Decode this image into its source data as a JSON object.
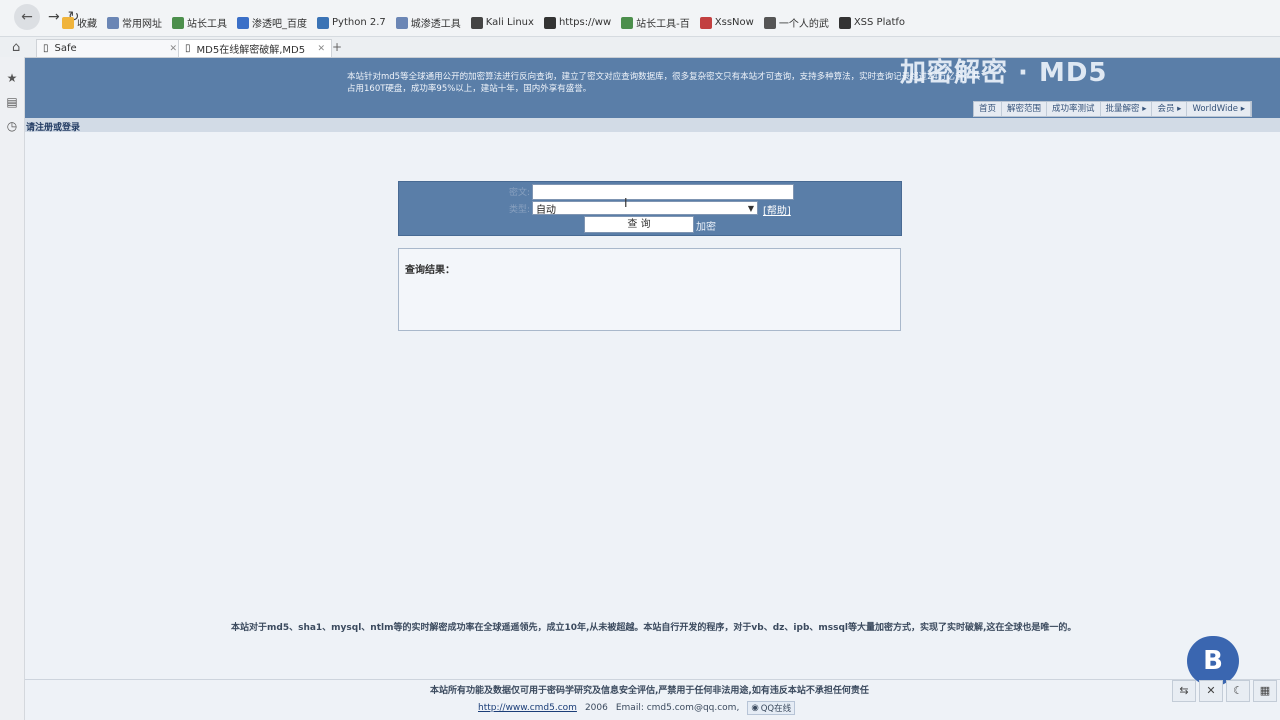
{
  "browser": {
    "bookmarks": [
      {
        "label": "收藏",
        "icon": "star-icon",
        "color": "#f0b43c"
      },
      {
        "label": "常用网址",
        "icon": "folder-icon",
        "color": "#6b86b5"
      },
      {
        "label": "站长工具",
        "icon": "tool-icon",
        "color": "#4c8f4c"
      },
      {
        "label": "渗透吧_百度",
        "icon": "paw-icon",
        "color": "#3a6fc7"
      },
      {
        "label": "Python 2.7",
        "icon": "python-icon",
        "color": "#3a73b5"
      },
      {
        "label": "城渗透工具",
        "icon": "folder-icon",
        "color": "#6b86b5"
      },
      {
        "label": "Kali Linux",
        "icon": "kali-icon",
        "color": "#444"
      },
      {
        "label": "https://ww",
        "icon": "page-icon",
        "color": "#333"
      },
      {
        "label": "站长工具-百",
        "icon": "tool-icon",
        "color": "#4c8f4c"
      },
      {
        "label": "XssNow",
        "icon": "x-icon",
        "color": "#c24040"
      },
      {
        "label": "一个人的武",
        "icon": "f-icon",
        "color": "#555"
      },
      {
        "label": "XSS Platfo",
        "icon": "xss-icon",
        "color": "#333"
      }
    ],
    "tabs": [
      {
        "label": "Safe"
      },
      {
        "label": "MD5在线解密破解,MD5"
      }
    ]
  },
  "site": {
    "header_text": "本站针对md5等全球通用公开的加密算法进行反向查询，建立了密文对应查询数据库，很多复杂密文只有本站才可查询，支持多种算法，实时查询记录超过24万亿条，共占用160T硬盘，成功率95%以上，建站十年，国内外享有盛誉。",
    "banner": "加密解密 · MD5",
    "nav": [
      "首页",
      "解密范围",
      "成功率测试",
      "批量解密 ▸",
      "会员 ▸",
      "WorldWide ▸"
    ],
    "login": "请注册或登录"
  },
  "form": {
    "label_cipher": "密文:",
    "label_type": "类型:",
    "input_value": "",
    "type_selected": "自动",
    "help": "[帮助]",
    "submit": "查 询",
    "encrypt": "加密"
  },
  "result": {
    "title": "查询结果："
  },
  "footer": {
    "line1": "本站对于md5、sha1、mysql、ntlm等的实时解密成功率在全球遥遥领先，成立10年,从未被超越。本站自行开发的程序，对于vb、dz、ipb、mssql等大量加密方式，实现了实时破解,这在全球也是唯一的。",
    "line2": "本站所有功能及数据仅可用于密码学研究及信息安全评估,严禁用于任何非法用途,如有违反本站不承担任何责任",
    "url": "http://www.cmd5.com",
    "year": "2006",
    "email": "Email: cmd5.com@qq.com,",
    "qq": "QQ在线"
  },
  "widgets": {
    "logo_letter": "B"
  }
}
